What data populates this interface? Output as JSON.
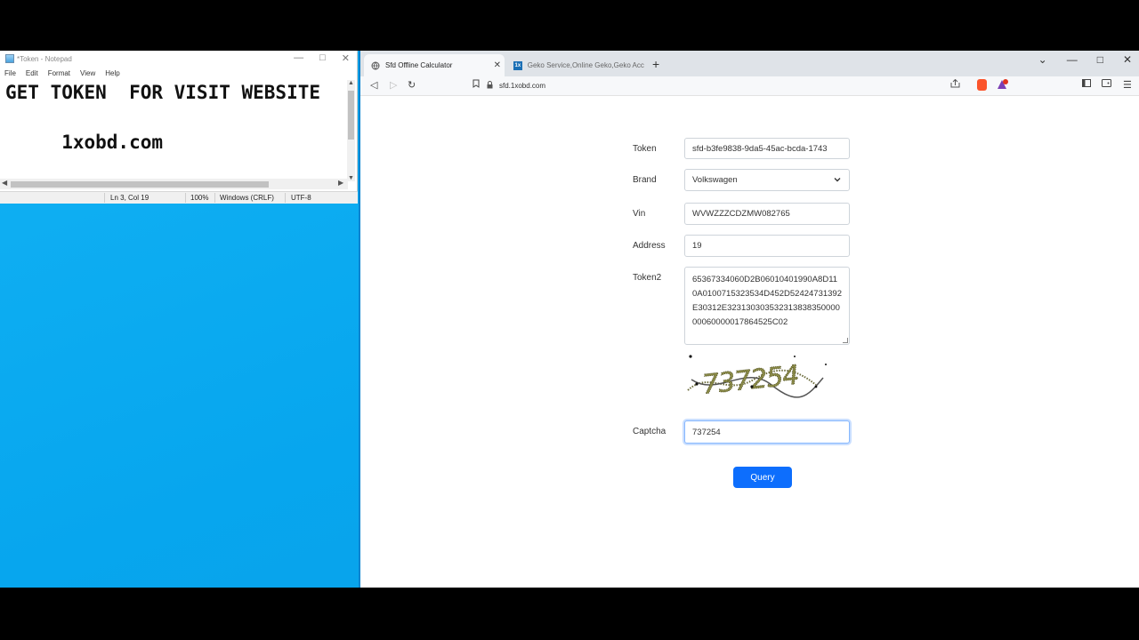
{
  "notepad": {
    "title": "*Token - Notepad",
    "menu": [
      "File",
      "Edit",
      "Format",
      "View",
      "Help"
    ],
    "lines": [
      "GET TOKEN  FOR VISIT WEBSITE",
      "",
      "     1xobd.com"
    ],
    "status": {
      "position": "Ln 3, Col 19",
      "zoom": "100%",
      "line_ending": "Windows (CRLF)",
      "encoding": "UTF-8"
    }
  },
  "browser": {
    "tabs": [
      {
        "title": "Sfd Offline Calculator",
        "active": true
      },
      {
        "title": "Geko Service,Online Geko,Geko Acco",
        "active": false
      }
    ],
    "url": "sfd.1xobd.com",
    "brave_badge": "",
    "colors": {
      "accent": "#0d6efd",
      "brave": "#fb542b"
    }
  },
  "form": {
    "token_label": "Token",
    "token_value": "sfd-b3fe9838-9da5-45ac-bcda-1743",
    "brand_label": "Brand",
    "brand_value": "Volkswagen",
    "vin_label": "Vin",
    "vin_value": "WVWZZZCDZMW082765",
    "address_label": "Address",
    "address_value": "19",
    "token2_label": "Token2",
    "token2_value": "65367334060D2B06010401990A8D110A0100715323534D452D52424731392E30312E32313030353231383835000000060000017864525C02",
    "captcha_image_text": "737254",
    "captcha_label": "Captcha",
    "captcha_value": "737254",
    "query_label": "Query"
  }
}
